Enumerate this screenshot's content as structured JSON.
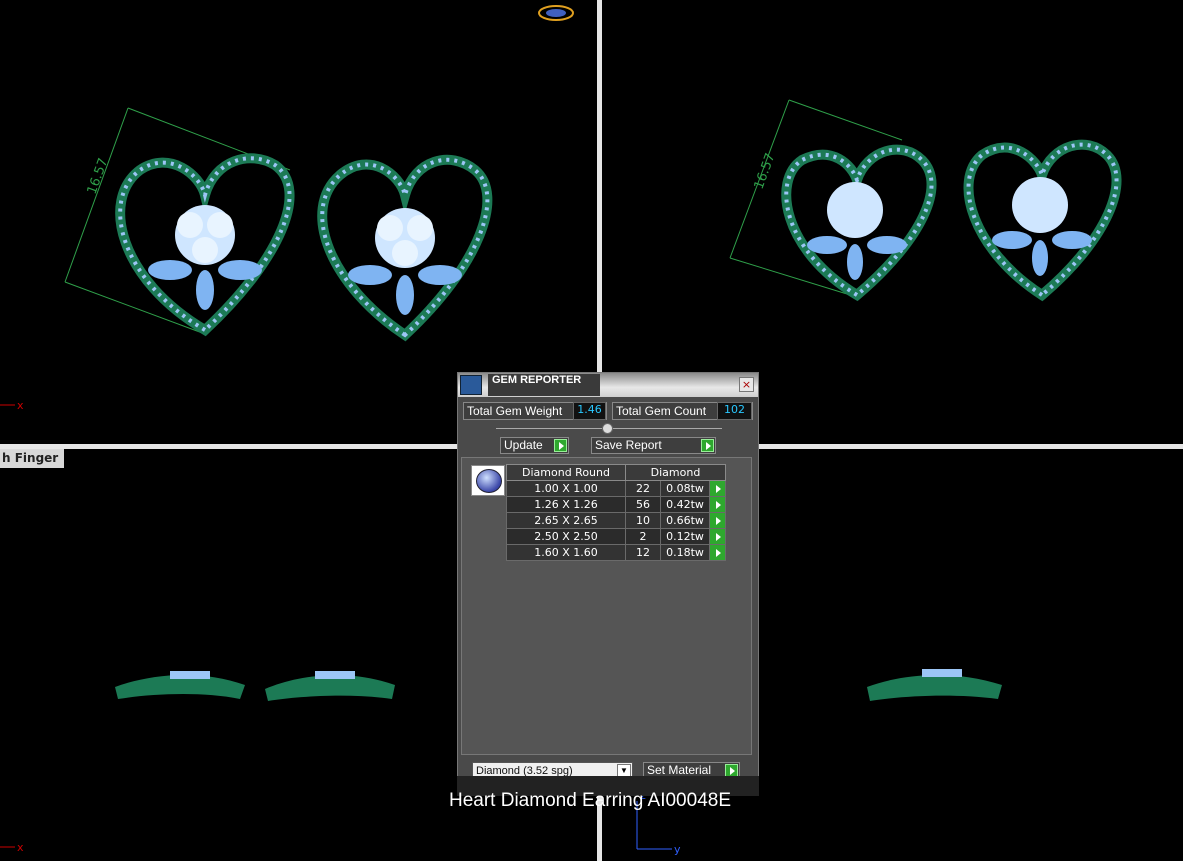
{
  "viewports": {
    "bottom_left_label": "h Finger",
    "dimension_label": "16.57",
    "axis_x": "x",
    "axis_y": "y",
    "axis_z": "z"
  },
  "gem_reporter": {
    "title": "GEM REPORTER",
    "close_label": "×",
    "total_gem_weight_label": "Total Gem Weight",
    "total_gem_weight": "1.46",
    "total_gem_count_label": "Total Gem Count",
    "total_gem_count": "102",
    "update_label": "Update",
    "save_report_label": "Save Report",
    "table": {
      "headers": [
        "Diamond Round",
        "Diamond"
      ],
      "rows": [
        {
          "size": "1.00 X 1.00",
          "count": "22",
          "weight": "0.08tw"
        },
        {
          "size": "1.26 X 1.26",
          "count": "56",
          "weight": "0.42tw"
        },
        {
          "size": "2.65 X 2.65",
          "count": "10",
          "weight": "0.66tw"
        },
        {
          "size": "2.50 X 2.50",
          "count": "2",
          "weight": "0.12tw"
        },
        {
          "size": "1.60 X 1.60",
          "count": "12",
          "weight": "0.18tw"
        }
      ]
    },
    "material_select": "Diamond     (3.52 spg)",
    "set_material_label": "Set Material"
  },
  "caption": "Heart Diamond Earring AI00048E",
  "colors": {
    "metal": "#1c7a55",
    "gem": "#7fb4f2",
    "dimension": "#2fa04a",
    "accent_value": "#2ac8ff"
  }
}
